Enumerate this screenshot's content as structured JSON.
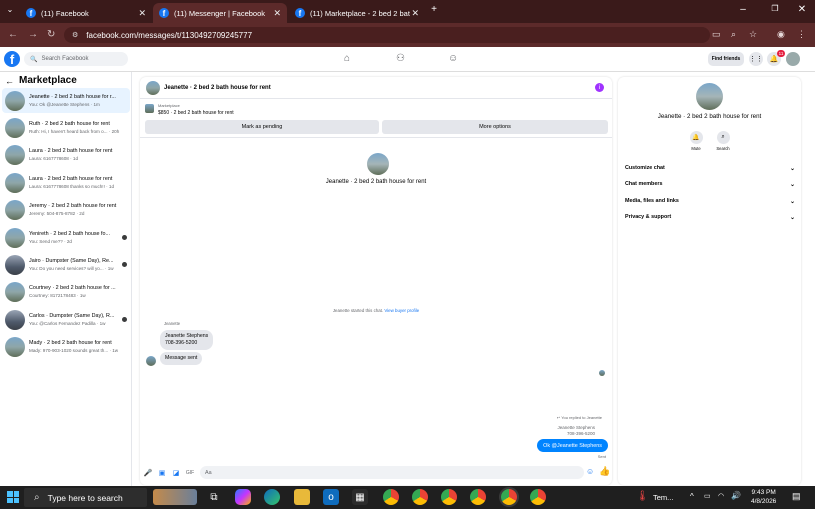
{
  "browser": {
    "tabs": [
      {
        "label": "(11) Facebook",
        "active": false
      },
      {
        "label": "(11) Messenger | Facebook",
        "active": true
      },
      {
        "label": "(11) Marketplace - 2 bed 2 bath",
        "active": false
      }
    ],
    "new_tab": "+",
    "url": "facebook.com/messages/t/1130492709245777"
  },
  "fb": {
    "search_placeholder": "Search Facebook",
    "find_friends": "Find friends",
    "notif_count": "11"
  },
  "marketplace": {
    "title": "Marketplace",
    "conversations": [
      {
        "title": "Jeanette · 2 bed 2 bath house for r...",
        "preview": "You: Ok @Jeanette Stephens · 1m",
        "selected": true,
        "dot": false,
        "avatar": "house"
      },
      {
        "title": "Ruth · 2 bed 2 bath house for rent",
        "preview": "Ruth: Hi, I haven't heard back from o... · 20h",
        "selected": false,
        "dot": false,
        "avatar": "house"
      },
      {
        "title": "Laura · 2 bed 2 bath house for rent",
        "preview": "Laura: 6167778608 · 1d",
        "selected": false,
        "dot": false,
        "avatar": "house"
      },
      {
        "title": "Laura · 2 bed 2 bath house for rent",
        "preview": "Laura: 6167778608 thanks so much!! · 1d",
        "selected": false,
        "dot": false,
        "avatar": "house"
      },
      {
        "title": "Jeremy · 2 bed 2 bath house for rent",
        "preview": "Jeremy: 504-875-8782 · 2d",
        "selected": false,
        "dot": false,
        "avatar": "house"
      },
      {
        "title": "Yenireth · 2 bed 2 bath house fo...",
        "preview": "You: Send me?? · 2d",
        "selected": false,
        "dot": true,
        "avatar": "house"
      },
      {
        "title": "Jairo · Dumpster (Same Day), Re...",
        "preview": "You: Do you need services? will yo... · 1w",
        "selected": false,
        "dot": true,
        "avatar": "dumpster"
      },
      {
        "title": "Courtney · 2 bed 2 bath house for ...",
        "preview": "Courtney: 8172178483 · 1w",
        "selected": false,
        "dot": false,
        "avatar": "house"
      },
      {
        "title": "Carlos · Dumpster (Same Day), R...",
        "preview": "You: @Carlos Fernandez Padilla · 1w",
        "selected": false,
        "dot": true,
        "avatar": "dumpster"
      },
      {
        "title": "Mady · 2 bed 2 bath house for rent",
        "preview": "Mady: 970-903-1020 sounds great th... · 1w",
        "selected": false,
        "dot": false,
        "avatar": "house"
      }
    ]
  },
  "chat": {
    "header_name": "Jeanette · 2 bed 2 bath house for rent",
    "listing_source": "Marketplace",
    "listing_price": "$850 · 2 bed 2 bath house for rent",
    "mark_pending": "Mark as pending",
    "more_options": "More options",
    "center_name": "Jeanette · 2 bed 2 bath house for rent",
    "started_text": "Jeanette started this chat.",
    "buyer_profile_link": "View buyer profile",
    "sender_label": "Jeanette",
    "msg_contact_1": "Jeanette Stephens",
    "msg_contact_2": "708-396-5200",
    "msg_sent": "Message sent",
    "replied_label": "You replied to Jeanette",
    "quoted_1": "Jeanette Stephens",
    "quoted_2": "708-396-5200",
    "my_reply": "Ok @Jeanette Stephens",
    "status": "Sent",
    "composer_placeholder": "Aa"
  },
  "info": {
    "name": "Jeanette · 2 bed 2 bath house for rent",
    "mute": "Mute",
    "search": "Search",
    "sections": [
      "Customize chat",
      "Chat members",
      "Media, files and links",
      "Privacy & support"
    ]
  },
  "taskbar": {
    "search_placeholder": "Type here to search",
    "weather": "Tem...",
    "time": "9:43 PM",
    "date": "4/8/2026"
  },
  "colors": {
    "accent": "#1877f2",
    "browser_frame": "#5c2a2a",
    "messenger_blue": "#0084ff"
  }
}
